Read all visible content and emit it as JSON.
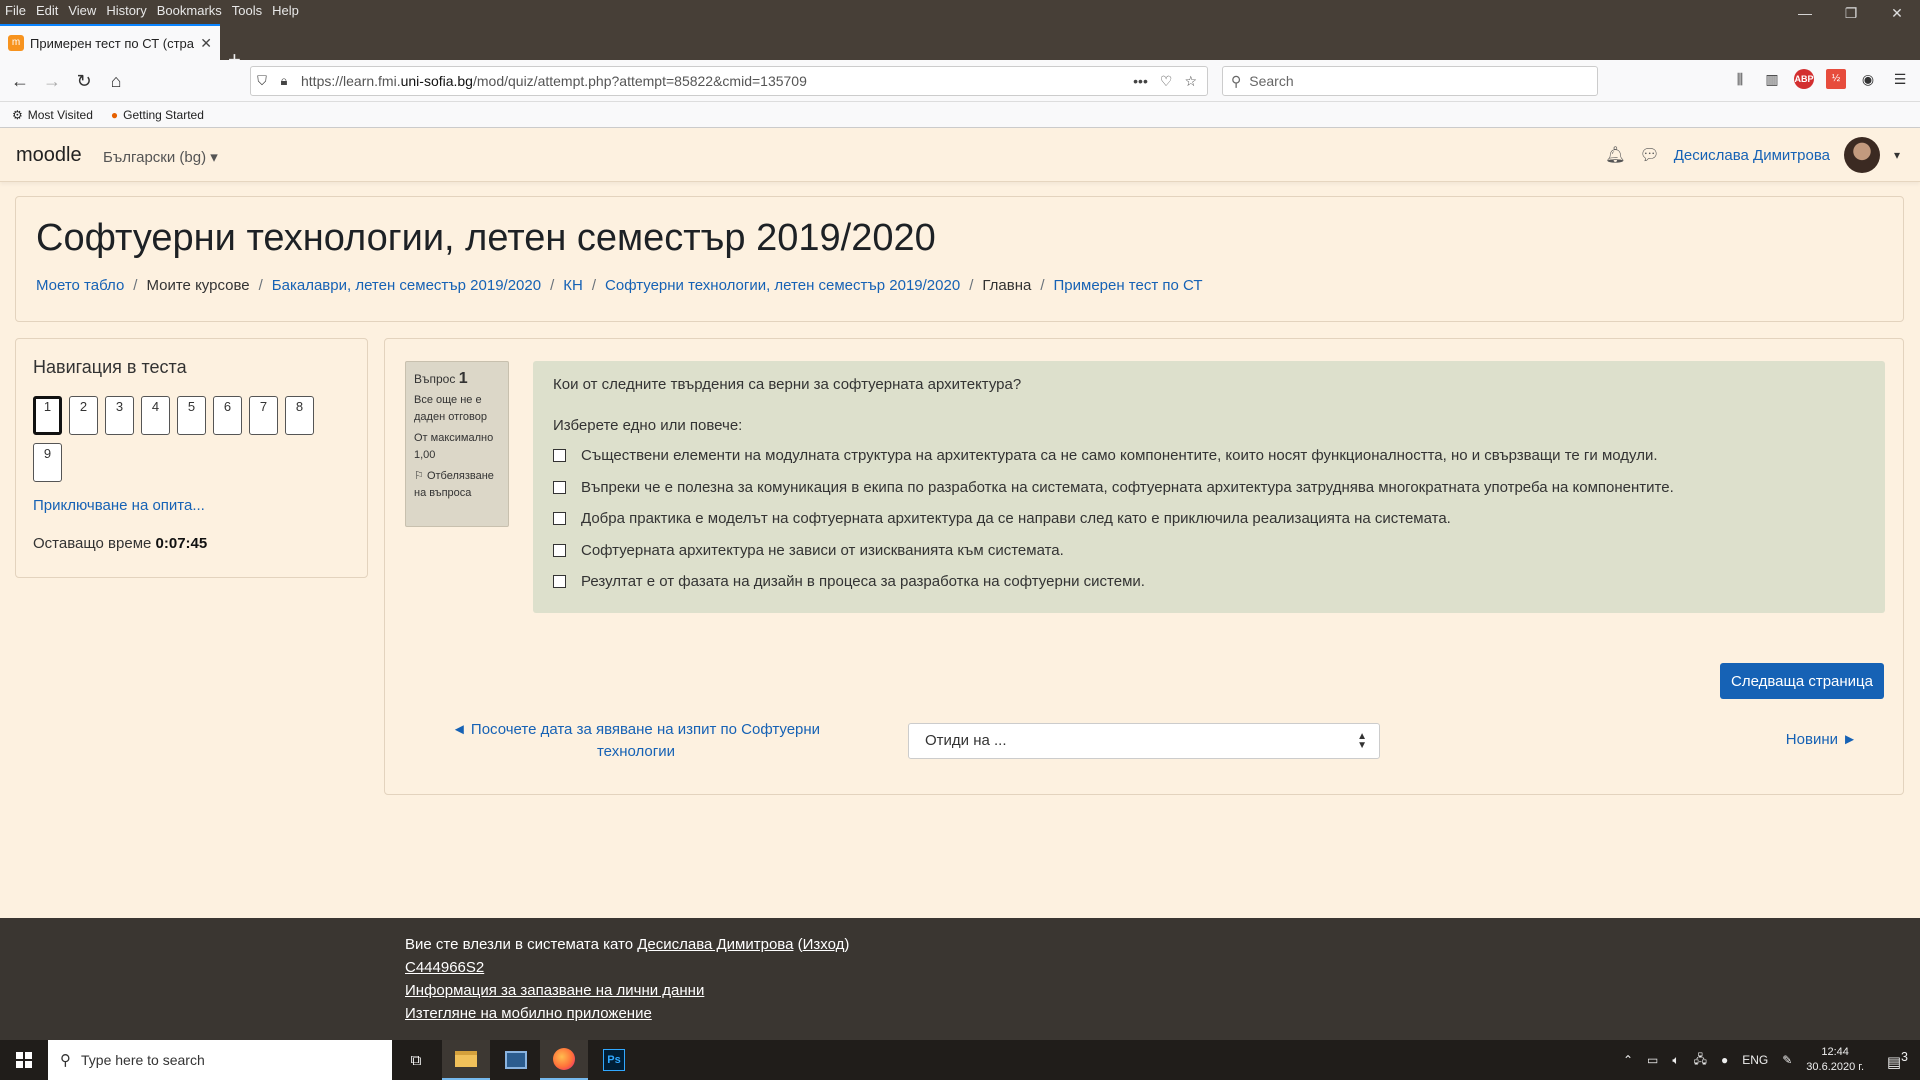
{
  "browser": {
    "menu": [
      "File",
      "Edit",
      "View",
      "History",
      "Bookmarks",
      "Tools",
      "Help"
    ],
    "tab_title": "Примерен тест по СТ (страни",
    "url_prefix": "https://learn.fmi.",
    "url_domain": "uni-sofia.bg",
    "url_path": "/mod/quiz/attempt.php?attempt=85822&cmid=135709",
    "search_placeholder": "Search",
    "bookmarks": [
      "Most Visited",
      "Getting Started"
    ]
  },
  "moodle": {
    "logo": "moodle",
    "language": "Български (bg)",
    "user_name": "Десислава Димитрова"
  },
  "course": {
    "title": "Софтуерни технологии, летен семестър 2019/2020",
    "breadcrumb": [
      {
        "label": "Моето табло",
        "link": true
      },
      {
        "label": "Моите курсове",
        "link": false
      },
      {
        "label": "Бакалаври, летен семестър 2019/2020",
        "link": true
      },
      {
        "label": "КН",
        "link": true
      },
      {
        "label": "Софтуерни технологии, летен семестър 2019/2020",
        "link": true
      },
      {
        "label": "Главна",
        "link": false
      },
      {
        "label": "Примерен тест по СТ",
        "link": true
      }
    ]
  },
  "quiz_nav": {
    "title": "Навигация в теста",
    "questions": [
      "1",
      "2",
      "3",
      "4",
      "5",
      "6",
      "7",
      "8",
      "9"
    ],
    "current": "1",
    "finish_label": "Приключване на опита...",
    "time_label": "Оставащо време",
    "time_value": "0:07:45"
  },
  "question": {
    "label": "Въпрос",
    "number": "1",
    "status": "Все още не е даден отговор",
    "max_label": "От максимално",
    "max_value": "1,00",
    "flag_label": "Отбелязване на въпроса",
    "text": "Кои от следните твърдения са верни за софтуерната архитектура?",
    "prompt": "Изберете едно или повече:",
    "options": [
      "Съществени елементи на модулната структура на архитектурата са не само компонентите, които носят функционалността, но и свързващи те ги модули.",
      "Въпреки че е полезна за комуникация в екипа по разработка на системата, софтуерната архитектура затруднява многократната употреба на компонентите.",
      "Добра практика е моделът на софтуерната архитектура да се направи след като е приключила реализацията на системата.",
      "Софтуерната архитектура не зависи от изискванията към системата.",
      "Резултат е от фазата на дизайн в процеса за разработка на софтуерни системи."
    ]
  },
  "page_nav": {
    "next_button": "Следваща страница",
    "prev_link": "◄ Посочете дата за явяване на изпит по Софтуерни технологии",
    "jump_placeholder": "Отиди на ...",
    "news_link": "Новини ►"
  },
  "footer": {
    "logged_in_text": "Вие сте влезли в системата като",
    "user_name": "Десислава Димитрова",
    "logout": "Изход",
    "code": "C444966S2",
    "privacy": "Информация за запазване на лични данни",
    "mobile": "Изтегляне на мобилно приложение"
  },
  "taskbar": {
    "search_placeholder": "Type here to search",
    "lang": "ENG",
    "time": "12:44",
    "date": "30.6.2020 г.",
    "notifications": "3"
  }
}
